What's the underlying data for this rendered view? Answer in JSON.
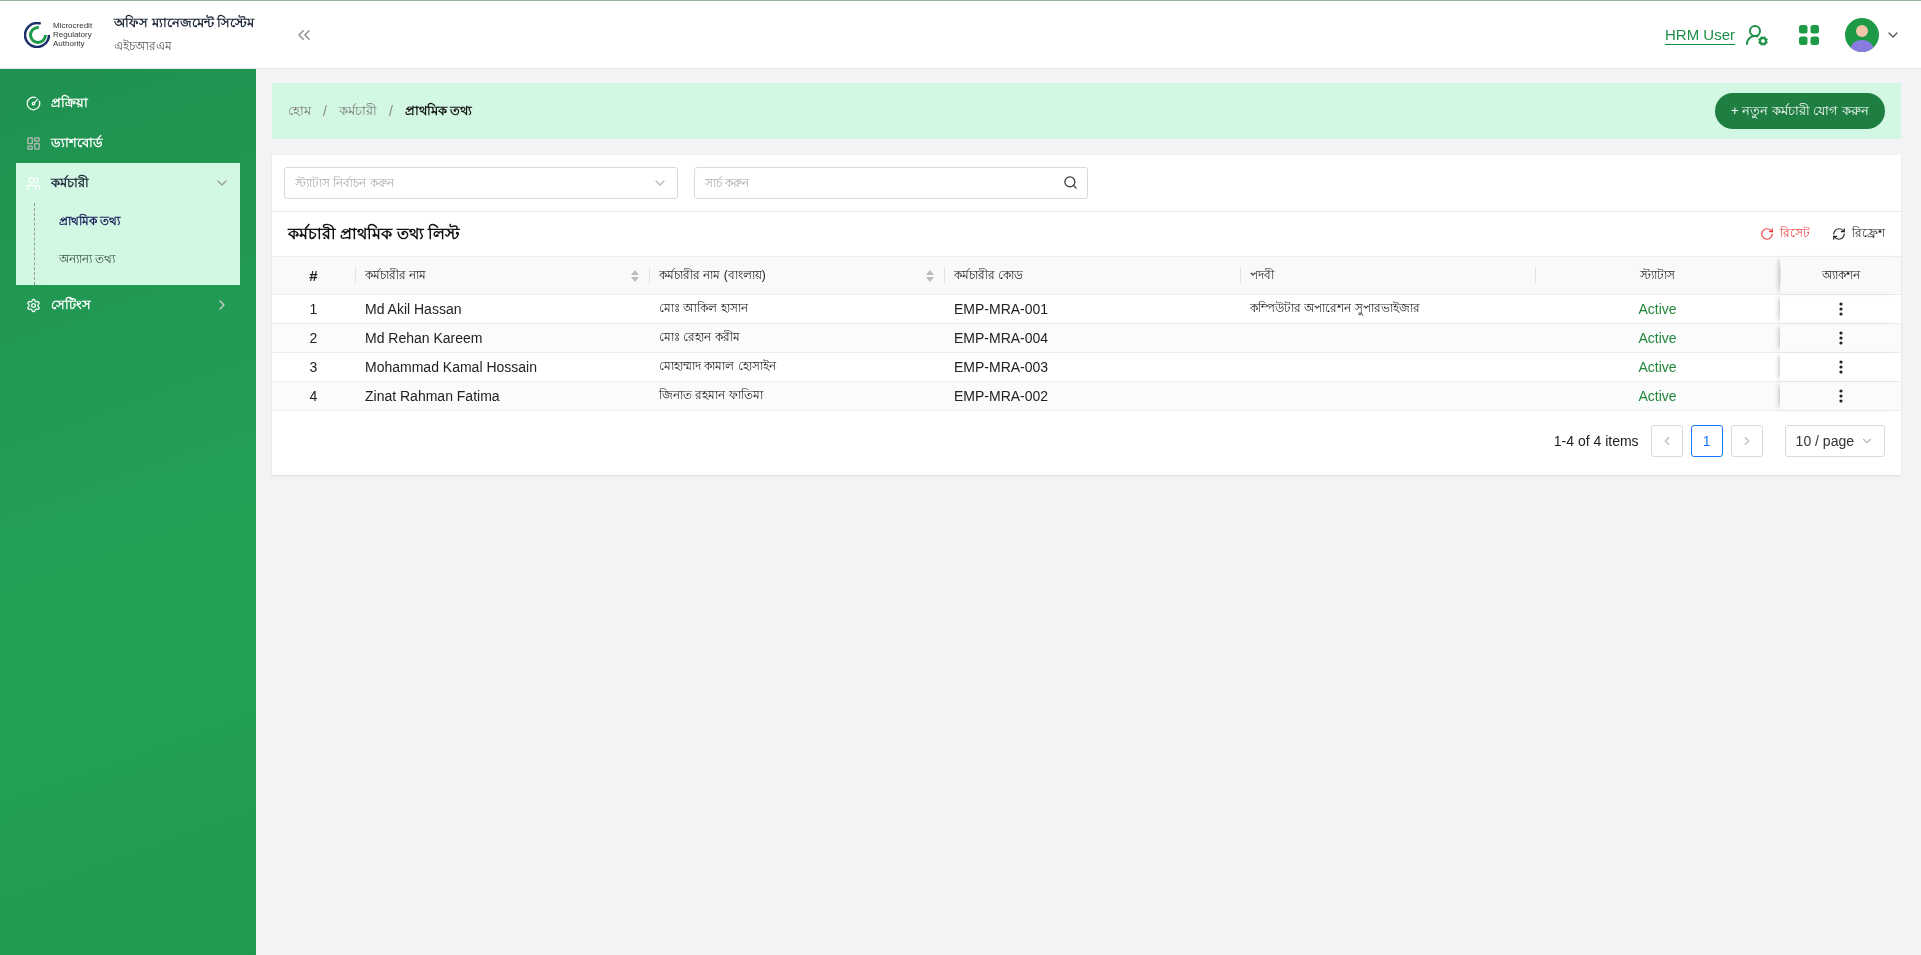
{
  "header": {
    "logo_lines": [
      "Microcredit",
      "Regulatory",
      "Authority"
    ],
    "app_title": "অফিস ম্যানেজমেন্ট সিস্টেম",
    "app_subtitle": "এইচআরএম",
    "user_link": "HRM User"
  },
  "sidebar": {
    "items": [
      {
        "kind": "link",
        "label": "প্রক্রিয়া",
        "selected": false
      },
      {
        "kind": "link",
        "label": "ড্যাশবোর্ড",
        "selected": false
      },
      {
        "kind": "group",
        "label": "কর্মচারী",
        "selected": true,
        "expanded": true,
        "children": [
          {
            "label": "প্রাথমিক তথ্য",
            "selected": true
          },
          {
            "label": "অন্যান্য তথ্য",
            "selected": false
          }
        ]
      },
      {
        "kind": "group",
        "label": "সেটিংস",
        "selected": false,
        "expanded": false
      }
    ]
  },
  "breadcrumb": {
    "separator": "/",
    "items": [
      "হোম",
      "কর্মচারী",
      "প্রাথমিক তথ্য"
    ]
  },
  "add_button": "+ নতুন কর্মচারী যোগ করুন",
  "filters": {
    "status_placeholder": "স্ট্যাটাস নির্বাচন করুন",
    "search_placeholder": "সার্চ করুন"
  },
  "list": {
    "title": "কর্মচারী প্রাথমিক তথ্য লিস্ট",
    "reset": "রিসেট",
    "refresh": "রিফ্রেশ"
  },
  "table": {
    "columns": [
      {
        "label": "#",
        "sortable": false
      },
      {
        "label": "কর্মচারীর নাম",
        "sortable": true
      },
      {
        "label": "কর্মচারীর নাম (বাংলায়)",
        "sortable": true
      },
      {
        "label": "কর্মচারীর কোড",
        "sortable": false
      },
      {
        "label": "পদবী",
        "sortable": false
      },
      {
        "label": "স্ট্যাটাস",
        "sortable": false
      },
      {
        "label": "অ্যাকশন",
        "sortable": false
      }
    ],
    "rows": [
      {
        "index": "1",
        "name": "Md Akil Hassan",
        "name_bn": "মোঃ আকিল হাসান",
        "code": "EMP-MRA-001",
        "designation": "কম্পিউটার অপারেশন সুপারভাইজার",
        "status": "Active"
      },
      {
        "index": "2",
        "name": "Md Rehan Kareem",
        "name_bn": "মোঃ রেহান করীম",
        "code": "EMP-MRA-004",
        "status": "Active"
      },
      {
        "index": "3",
        "name": "Mohammad Kamal Hossain",
        "name_bn": "মোহাম্মাদ কামাল হোসাইন",
        "code": "EMP-MRA-003",
        "status": "Active"
      },
      {
        "index": "4",
        "name": "Zinat Rahman Fatima",
        "name_bn": "জিনাত রহমান ফাতিমা",
        "code": "EMP-MRA-002",
        "status": "Active"
      }
    ]
  },
  "pagination": {
    "summary": "1-4 of 4 items",
    "prev_disabled": true,
    "next_disabled": true,
    "pages": [
      {
        "label": "1",
        "selected": true
      }
    ],
    "page_size": "10 / page"
  }
}
